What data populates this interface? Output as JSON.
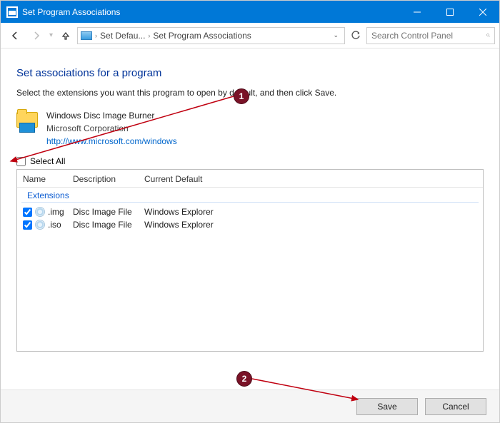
{
  "window": {
    "title": "Set Program Associations"
  },
  "nav": {
    "crumb1": "Set Defau...",
    "crumb2": "Set Program Associations",
    "search_placeholder": "Search Control Panel"
  },
  "page": {
    "heading": "Set associations for a program",
    "instruction": "Select the extensions you want this program to open by default, and then click Save."
  },
  "program": {
    "name": "Windows Disc Image Burner",
    "company": "Microsoft Corporation",
    "url": "http://www.microsoft.com/windows"
  },
  "select_all_label": "Select All",
  "columns": {
    "name": "Name",
    "desc": "Description",
    "def": "Current Default"
  },
  "group_label": "Extensions",
  "rows": [
    {
      "checked": true,
      "ext": ".img",
      "desc": "Disc Image File",
      "def": "Windows Explorer"
    },
    {
      "checked": true,
      "ext": ".iso",
      "desc": "Disc Image File",
      "def": "Windows Explorer"
    }
  ],
  "buttons": {
    "save": "Save",
    "cancel": "Cancel"
  },
  "callouts": {
    "one": "1",
    "two": "2"
  }
}
